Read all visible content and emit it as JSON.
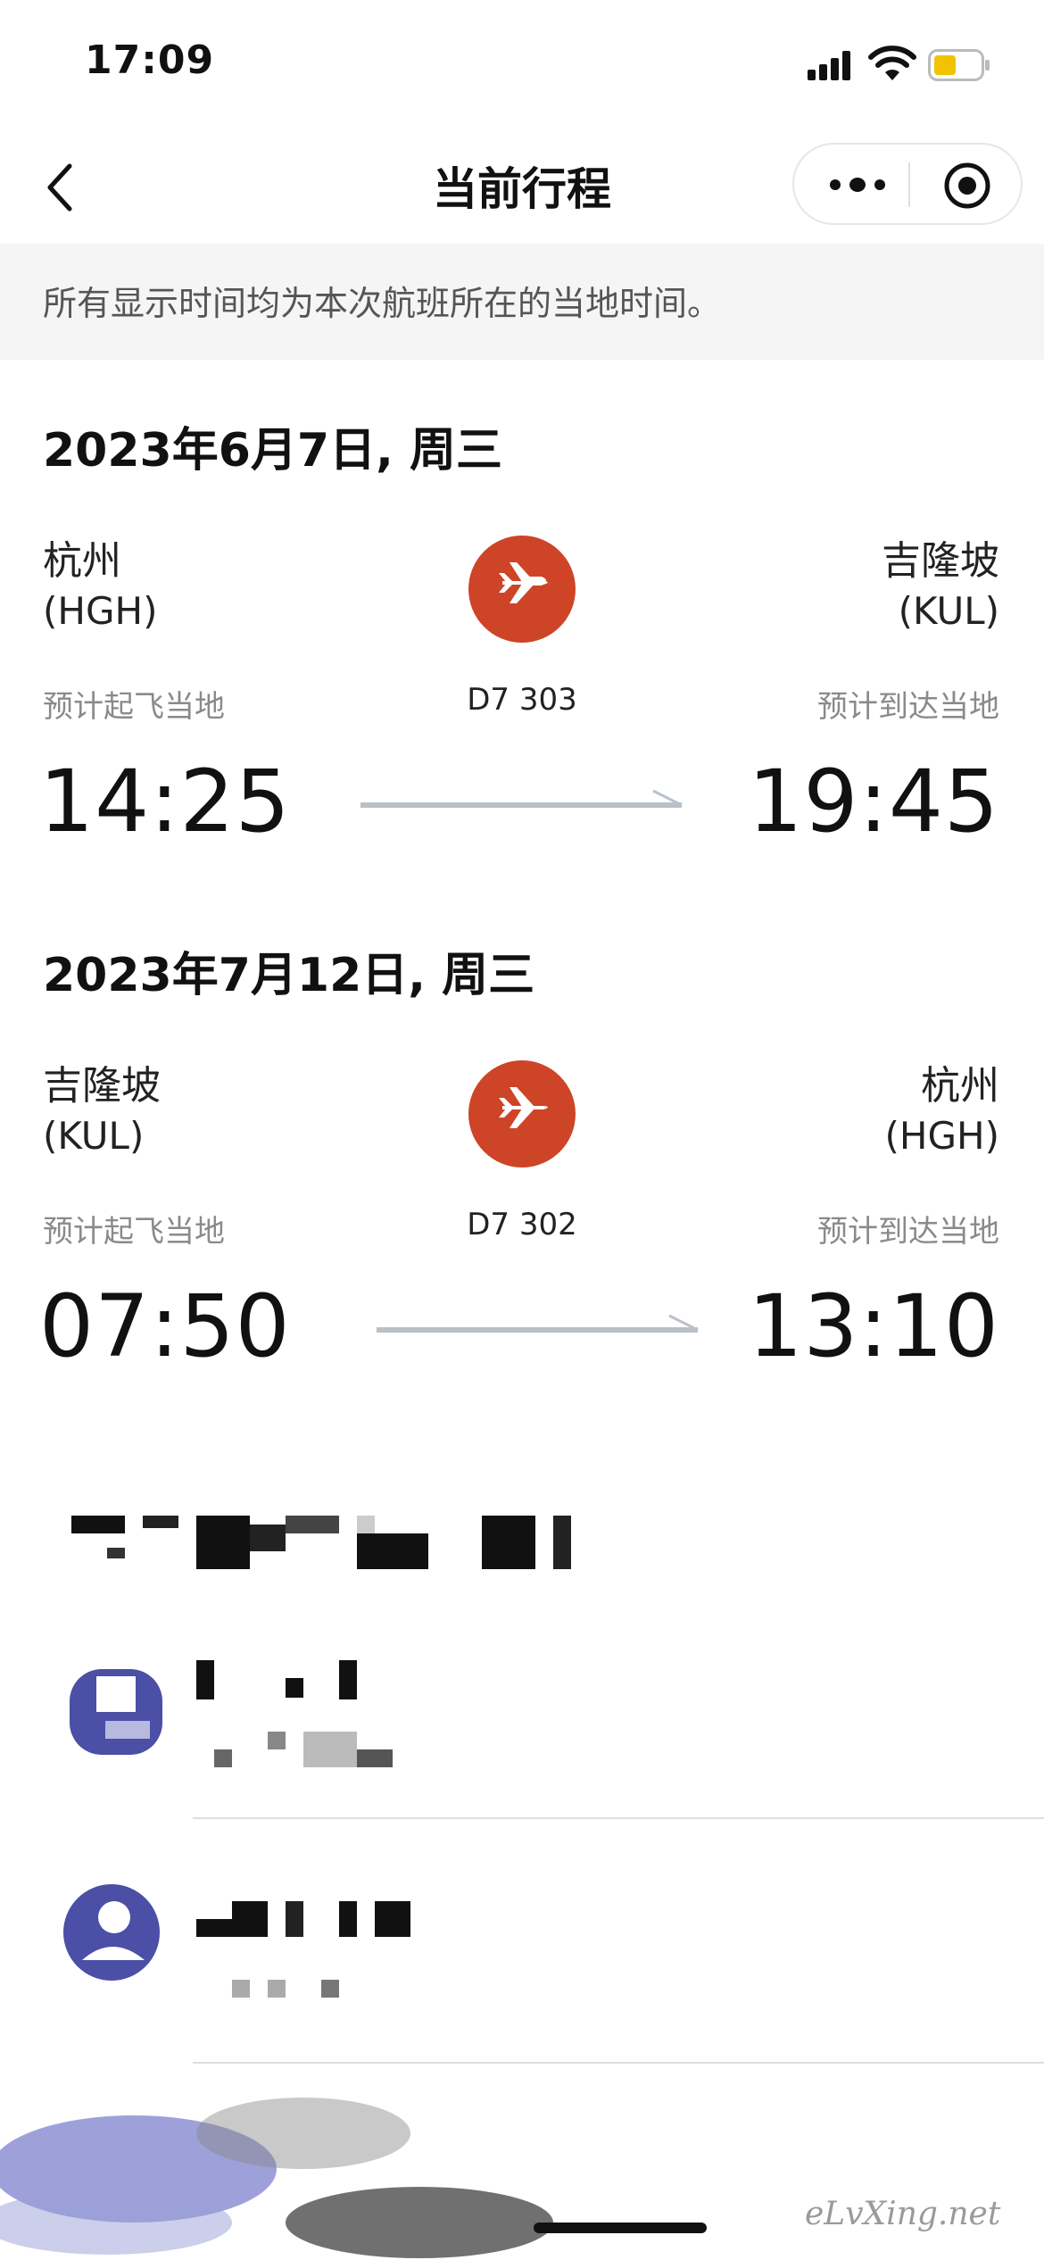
{
  "status_bar": {
    "time": "17:09"
  },
  "nav": {
    "title": "当前行程"
  },
  "notice": "所有显示时间均为本次航班所在的当地时间。",
  "flights": [
    {
      "date": "2023年6月7日, 周三",
      "from_city": "杭州",
      "from_code": "(HGH)",
      "to_city": "吉隆坡",
      "to_code": "(KUL)",
      "flight_no": "D7 303",
      "depart_label": "预计起飞当地",
      "arrive_label": "预计到达当地",
      "depart_time": "14:25",
      "arrive_time": "19:45"
    },
    {
      "date": "2023年7月12日, 周三",
      "from_city": "吉隆坡",
      "from_code": "(KUL)",
      "to_city": "杭州",
      "to_code": "(HGH)",
      "flight_no": "D7 302",
      "depart_label": "预计起飞当地",
      "arrive_label": "预计到达当地",
      "depart_time": "07:50",
      "arrive_time": "13:10"
    }
  ],
  "colors": {
    "accent": "#cd4427",
    "avatar": "#4b4fa6"
  },
  "watermark": "eLvXing.net"
}
